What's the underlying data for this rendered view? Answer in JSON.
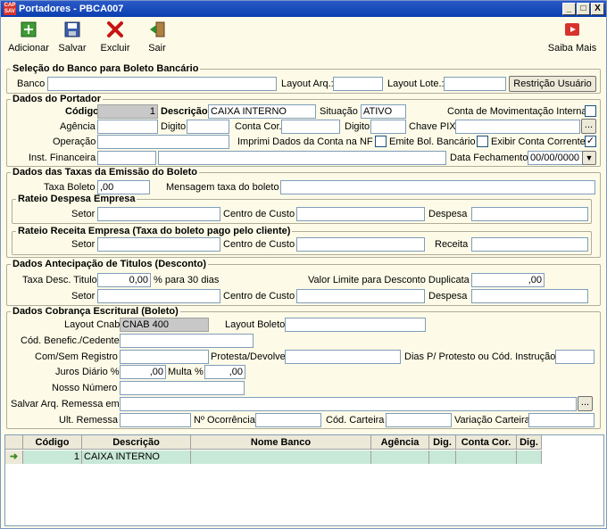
{
  "window": {
    "title": "Portadores - PBCA007",
    "app_icon_text": "CAP SAV",
    "minimize_label": "_",
    "maximize_label": "□",
    "close_label": "X"
  },
  "toolbar": {
    "add_label": "Adicionar",
    "save_label": "Salvar",
    "delete_label": "Excluir",
    "exit_label": "Sair",
    "about_label": "Saiba Mais"
  },
  "banco": {
    "legend": "Seleção do Banco para Boleto Bancário",
    "banco_label": "Banco",
    "banco_value": "",
    "layout_arq_label": "Layout Arq.:",
    "layout_arq_value": "",
    "layout_lote_label": "Layout Lote.:",
    "layout_lote_value": "",
    "restricao_button": "Restrição Usuário"
  },
  "portador": {
    "legend": "Dados do Portador",
    "codigo_label": "Código",
    "codigo_value": "1",
    "descricao_label": "Descrição",
    "descricao_value": "CAIXA INTERNO",
    "situacao_label": "Situação",
    "situacao_value": "ATIVO",
    "conta_mov_label": "Conta de Movimentação Interna",
    "agencia_label": "Agência",
    "digito_label": "Digito",
    "conta_cor_label": "Conta Cor.",
    "digito2_label": "Digito",
    "chave_pix_label": "Chave PIX",
    "ellipsis": "...",
    "operacao_label": "Operação",
    "imprimi_label": "Imprimi Dados da Conta na NF",
    "emite_label": "Emite Bol. Bancário",
    "exibir_label": "Exibir Conta Corrente",
    "exibir_check": "✓",
    "inst_fin_label": "Inst. Financeira",
    "data_fech_label": "Data Fechamento",
    "data_fech_value": "00/00/0000",
    "dropdown_arrow": "▼"
  },
  "taxas": {
    "legend": "Dados das Taxas da Emissão do Boleto",
    "taxa_boleto_label": "Taxa Boleto",
    "taxa_boleto_value": ",00",
    "mensagem_label": "Mensagem taxa do boleto",
    "rateio_despesa_legend": "Rateio Despesa Empresa",
    "setor_label": "Setor",
    "centro_label": "Centro de Custo",
    "despesa_label": "Despesa",
    "rateio_receita_legend": "Rateio Receita Empresa (Taxa do boleto pago pelo cliente)",
    "setor2_label": "Setor",
    "centro2_label": "Centro de Custo",
    "receita_label": "Receita"
  },
  "antecipacao": {
    "legend": "Dados Antecipação de Titulos (Desconto)",
    "taxa_desc_label": "Taxa Desc. Titulo",
    "taxa_desc_value": "0,00",
    "para30_label": "% para 30 dias",
    "valor_limite_label": "Valor Limite para Desconto Duplicata",
    "valor_limite_value": ",00",
    "setor_label": "Setor",
    "centro_label": "Centro de Custo",
    "despesa_label": "Despesa"
  },
  "cobranca": {
    "legend": "Dados Cobrança Escritural (Boleto)",
    "layout_cnab_label": "Layout Cnab",
    "layout_cnab_value": "CNAB 400",
    "layout_boleto_label": "Layout Boleto",
    "cod_benefic_label": "Cód. Benefic./Cedente",
    "com_sem_label": "Com/Sem Registro",
    "protesta_label": "Protesta/Devolve",
    "dias_label": "Dias P/ Protesto ou Cód. Instrução",
    "juros_label": "Juros Diário %",
    "juros_value": ",00",
    "multa_label": "Multa %",
    "multa_value": ",00",
    "nosso_label": "Nosso Número",
    "salvar_label": "Salvar Arq. Remessa em",
    "ult_label": "Ult. Remessa",
    "ocorrencia_label": "Nº Ocorrência",
    "cod_carteira_label": "Cód. Carteira",
    "variacao_label": "Variação Carteira"
  },
  "grid": {
    "columns": [
      "Código",
      "Descrição",
      "Nome Banco",
      "Agência",
      "Dig.",
      "Conta Cor.",
      "Dig."
    ],
    "rows": [
      {
        "codigo": "1",
        "descricao": "CAIXA INTERNO",
        "nome_banco": "",
        "agencia": "",
        "dig": "",
        "conta": "",
        "dig2": ""
      }
    ],
    "row_pointer": "➜"
  },
  "colors": {
    "background": "#fdfbe7",
    "titlebar": "#0a3fb0",
    "grid_row": "#c8e8d8"
  }
}
